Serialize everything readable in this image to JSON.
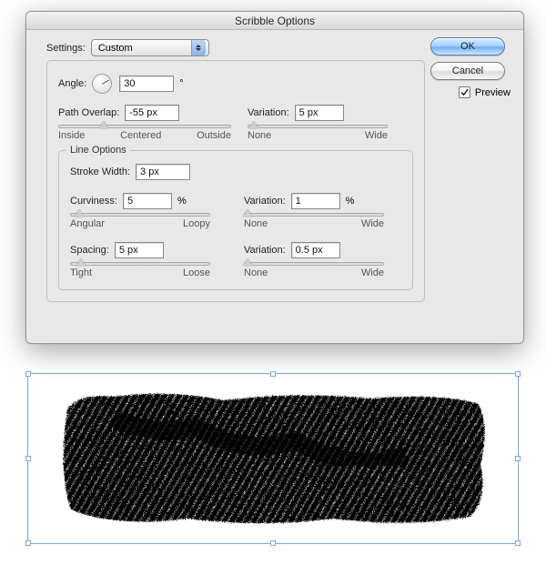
{
  "dialog": {
    "title": "Scribble Options",
    "settings_label": "Settings:",
    "settings_value": "Custom",
    "angle_label": "Angle:",
    "angle_value": "30",
    "angle_unit": "°",
    "path_overlap_label": "Path Overlap:",
    "path_overlap_value": "-55 px",
    "path_overlap_slider": {
      "left": "Inside",
      "center": "Centered",
      "right": "Outside",
      "pos": 26
    },
    "path_variation_label": "Variation:",
    "path_variation_value": "5 px",
    "path_variation_slider": {
      "left": "None",
      "right": "Wide",
      "pos": 4
    },
    "line_options_legend": "Line Options",
    "stroke_width_label": "Stroke Width:",
    "stroke_width_value": "3 px",
    "curviness_label": "Curviness:",
    "curviness_value": "5",
    "curviness_unit": "%",
    "curviness_slider": {
      "left": "Angular",
      "right": "Loopy",
      "pos": 6
    },
    "curv_variation_label": "Variation:",
    "curv_variation_value": "1",
    "curv_variation_unit": "%",
    "curv_variation_slider": {
      "left": "None",
      "right": "Wide",
      "pos": 2
    },
    "spacing_label": "Spacing:",
    "spacing_value": "5 px",
    "spacing_slider": {
      "left": "Tight",
      "right": "Loose",
      "pos": 7
    },
    "spacing_variation_label": "Variation:",
    "spacing_variation_value": "0.5 px",
    "spacing_variation_slider": {
      "left": "None",
      "right": "Wide",
      "pos": 2
    }
  },
  "buttons": {
    "ok": "OK",
    "cancel": "Cancel",
    "preview_label": "Preview",
    "preview_checked": true
  }
}
